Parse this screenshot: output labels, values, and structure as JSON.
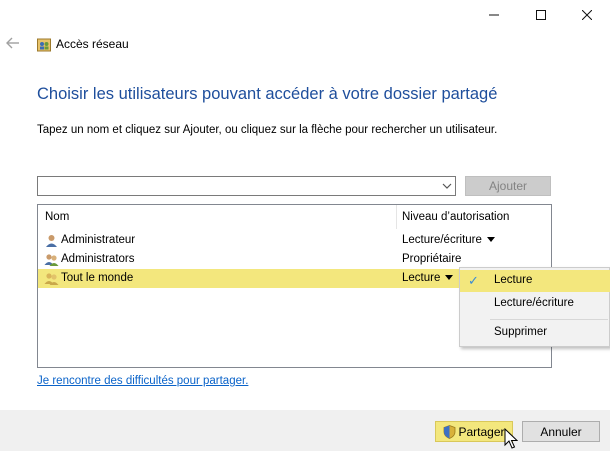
{
  "window": {
    "title": "Accès réseau",
    "controls": {
      "minimize": "minimize-icon",
      "maximize": "maximize-icon",
      "close": "close-icon"
    }
  },
  "heading": "Choisir les utilisateurs pouvant accéder à votre dossier partagé",
  "instruction": "Tapez un nom et cliquez sur Ajouter, ou cliquez sur la flèche pour rechercher un utilisateur.",
  "name_input": {
    "value": "",
    "placeholder": ""
  },
  "add_button": "Ajouter",
  "table": {
    "columns": [
      "Nom",
      "Niveau d’autorisation"
    ],
    "rows": [
      {
        "name": "Administrateur",
        "level": "Lecture/écriture",
        "icon": "user-icon",
        "has_dropdown": true
      },
      {
        "name": "Administrators",
        "level": "Propriétaire",
        "icon": "group-icon",
        "has_dropdown": false
      },
      {
        "name": "Tout le monde",
        "level": "Lecture",
        "icon": "group-icon",
        "has_dropdown": true,
        "selected": true
      }
    ]
  },
  "permission_menu": {
    "items": [
      {
        "label": "Lecture",
        "checked": true
      },
      {
        "label": "Lecture/écriture",
        "checked": false
      },
      {
        "label": "Supprimer",
        "checked": false
      }
    ]
  },
  "help_link": "Je rencontre des difficultés pour partager.",
  "footer": {
    "share_button": "Partager",
    "cancel_button": "Annuler"
  },
  "colors": {
    "accent_title": "#1e4e9c",
    "highlight": "#f3e77d",
    "link": "#0a63c9",
    "footer_bg": "#f0f0f0"
  }
}
